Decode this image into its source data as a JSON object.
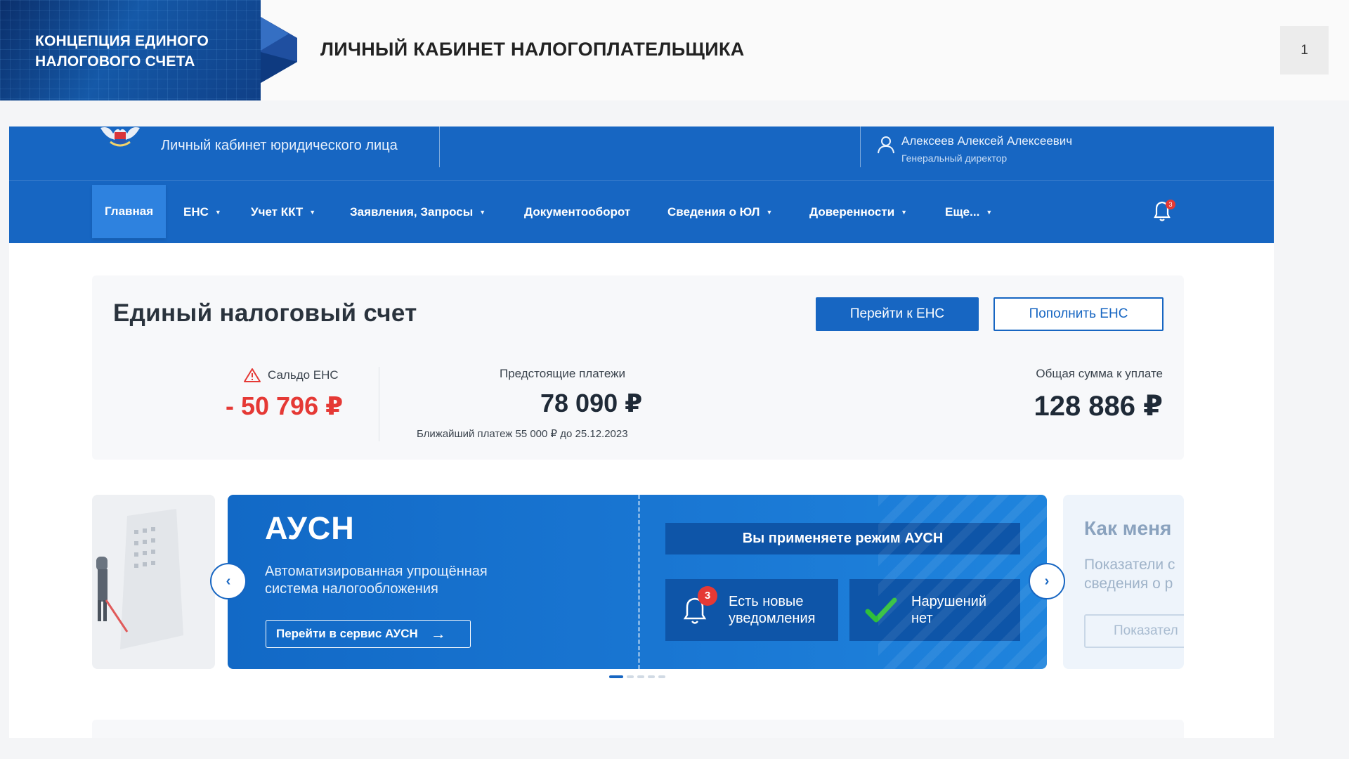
{
  "slide": {
    "badge_title": "КОНЦЕПЦИЯ ЕДИНОГО\nНАЛОГОВОГО СЧЕТА",
    "title": "ЛИЧНЫЙ КАБИНЕТ НАЛОГОПЛАТЕЛЬЩИКА",
    "page_number": "1"
  },
  "topbar": {
    "cabinet_title": "Личный кабинет юридического лица",
    "user_name": "Алексеев Алексей Алексеевич",
    "user_role": "Генеральный директор",
    "icons": [
      "emblem-icon",
      "user-icon"
    ]
  },
  "nav": {
    "items": [
      {
        "label": "Главная",
        "has_caret": false,
        "active": true
      },
      {
        "label": "ЕНС",
        "has_caret": true
      },
      {
        "label": "Учет ККТ",
        "has_caret": true
      },
      {
        "label": "Заявления, Запросы",
        "has_caret": true
      },
      {
        "label": "Документооборот",
        "has_caret": false
      },
      {
        "label": "Сведения о ЮЛ",
        "has_caret": true
      },
      {
        "label": "Доверенности",
        "has_caret": true
      },
      {
        "label": "Еще...",
        "has_caret": true
      }
    ],
    "caret": "▼",
    "bell_icon": "bell-icon",
    "bell_badge": "3"
  },
  "ens": {
    "title": "Единый налоговый счет",
    "go_button": "Перейти к ЕНС",
    "topup_button": "Пополнить ЕНС",
    "saldo_label": "Сальдо ЕНС",
    "saldo_value": "- 50 796 ₽",
    "upcoming_label": "Предстоящие платежи",
    "upcoming_value": "78 090 ₽",
    "next_payment": "Ближайший платеж 55 000 ₽ до 25.12.2023",
    "total_label": "Общая сумма к уплате",
    "total_value": "128 886 ₽"
  },
  "carousel": {
    "main": {
      "title": "АУСН",
      "description": "Автоматизированная упрощённая\nсистема налогообложения",
      "service_button": "Перейти в сервис АУСН",
      "regime_bar": "Вы применяете режим АУСН",
      "notify_tile": "Есть новые\nуведомления",
      "notify_badge": "3",
      "ok_tile": "Нарушений\nнет"
    },
    "right_card": {
      "title": "Как меня",
      "text": "Показатели с\nсведения о р",
      "button": "Показател"
    },
    "prev_symbol": "‹",
    "next_symbol": "›",
    "arrow_symbol": "→",
    "dots_count": 5,
    "active_dot": 0
  },
  "colors": {
    "brand_blue": "#1766c2",
    "accent_red": "#e53935",
    "success_green": "#2fbf3a"
  }
}
